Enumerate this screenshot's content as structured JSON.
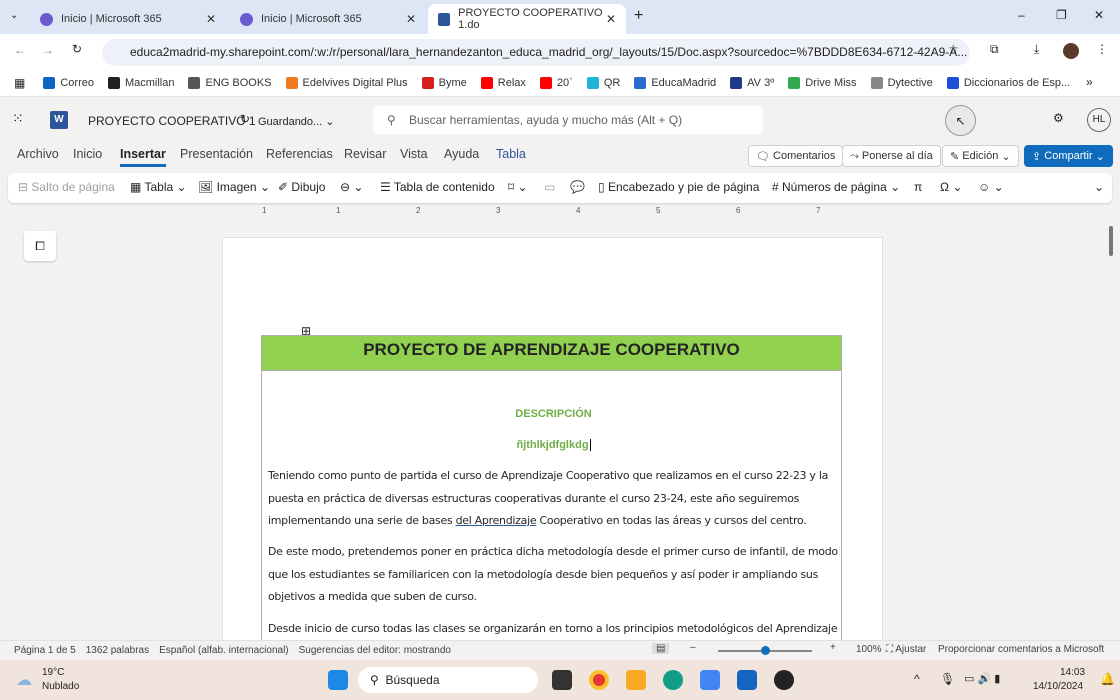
{
  "browser": {
    "tabs": [
      {
        "label": "Inicio | Microsoft 365"
      },
      {
        "label": "Inicio | Microsoft 365"
      },
      {
        "label": "PROYECTO COOPERATIVO 1.do"
      }
    ],
    "url": "educa2madrid-my.sharepoint.com/:w:/r/personal/lara_hernandezanton_educa_madrid_org/_layouts/15/Doc.aspx?sourcedoc=%7BDDD8E634-6712-42A9-A...",
    "bookmarks": [
      {
        "label": "Correo",
        "color": "#0a66c2"
      },
      {
        "label": "Macmillan",
        "color": "#222222"
      },
      {
        "label": "ENG BOOKS",
        "color": "#555555"
      },
      {
        "label": "Edelvives Digital Plus",
        "color": "#f07a22"
      },
      {
        "label": "Byme",
        "color": "#d81e1e"
      },
      {
        "label": "Relax",
        "color": "#ff0000"
      },
      {
        "label": "20`",
        "color": "#ff0000"
      },
      {
        "label": "QR",
        "color": "#1fb5d6"
      },
      {
        "label": "EducaMadrid",
        "color": "#2a6bd1"
      },
      {
        "label": "AV 3º",
        "color": "#1e3a8a"
      },
      {
        "label": "Drive Miss",
        "color": "#34a853"
      },
      {
        "label": "Dytective",
        "color": "#888888"
      },
      {
        "label": "Diccionarios de Esp...",
        "color": "#1d4ed8"
      }
    ]
  },
  "word": {
    "doc_title": "PROYECTO COOPERATIVO 1",
    "save_status": "Guardando...",
    "search_placeholder": "Buscar herramientas, ayuda y mucho más (Alt + Q)",
    "avatar": "HL",
    "ribbon_tabs": [
      "Archivo",
      "Inicio",
      "Insertar",
      "Presentación",
      "Referencias",
      "Revisar",
      "Vista",
      "Ayuda",
      "Tabla"
    ],
    "active_tab": "Insertar",
    "buttons": {
      "comments": "Comentarios",
      "catchup": "Ponerse al día",
      "editing": "Edición",
      "share": "Compartir"
    },
    "toolbar": {
      "page_break": "Salto de página",
      "table": "Tabla",
      "image": "Imagen",
      "drawing": "Dibujo",
      "toc": "Tabla de contenido",
      "header_footer": "Encabezado y pie de página",
      "page_numbers": "Números de página",
      "equation": "π",
      "symbol": "Ω"
    },
    "ruler": [
      "1",
      "1",
      "2",
      "3",
      "4",
      "5",
      "6",
      "7"
    ]
  },
  "document": {
    "title": "PROYECTO DE APRENDIZAJE COOPERATIVO",
    "heading": "DESCRIPCIÓN",
    "typed": "ñjthlkjdfglkdg",
    "p1a": "Teniendo como punto de partida el curso de Aprendizaje Cooperativo que realizamos en el curso 22-23 y la puesta en práctica de diversas estructuras cooperativas durante el curso 23-24, este año seguiremos implementando una serie de bases ",
    "p1link": "del  Aprendizaje",
    "p1b": " Cooperativo en todas las áreas y cursos del centro.",
    "p2": "De este modo, pretendemos poner en práctica dicha metodología desde el primer curso de infantil, de modo que los estudiantes se familiaricen con la metodología desde bien pequeños y así poder ir ampliando sus objetivos a medida que suben de curso.",
    "p3": "Desde inicio de curso todas las clases se organizarán en torno a los principios metodológicos del Aprendizaje"
  },
  "status": {
    "page": "Página 1 de 5",
    "words": "1362 palabras",
    "language": "Español (alfab. internacional)",
    "editor": "Sugerencias del editor: mostrando",
    "zoom": "100%",
    "zoom_value": 100,
    "fit": "Ajustar",
    "feedback": "Proporcionar comentarios a Microsoft"
  },
  "taskbar": {
    "temp": "19°C",
    "weather": "Nublado",
    "search": "Búsqueda",
    "time": "14:03",
    "date": "14/10/2024"
  }
}
